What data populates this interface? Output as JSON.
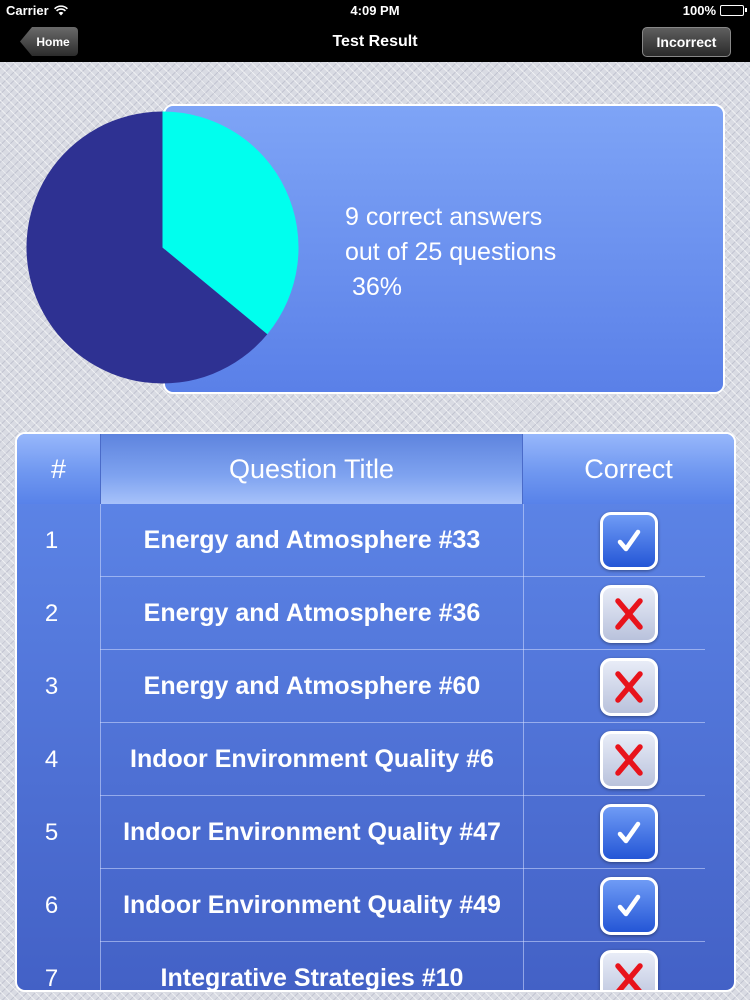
{
  "status_bar": {
    "carrier": "Carrier",
    "time": "4:09 PM",
    "battery": "100%"
  },
  "nav": {
    "home_label": "Home",
    "title": "Test Result",
    "incorrect_label": "Incorrect"
  },
  "summary": {
    "line1": "9 correct answers",
    "line2": "out of 25 questions",
    "line3": " 36%"
  },
  "chart_data": {
    "type": "pie",
    "slices": [
      {
        "label": "correct",
        "value": 36,
        "color": "#00ffee"
      },
      {
        "label": "incorrect",
        "value": 64,
        "color": "#2e3192"
      }
    ]
  },
  "table": {
    "headers": {
      "num": "#",
      "title": "Question Title",
      "correct": "Correct"
    },
    "rows": [
      {
        "num": "1",
        "title": "Energy and Atmosphere #33",
        "correct": true
      },
      {
        "num": "2",
        "title": "Energy and Atmosphere #36",
        "correct": false
      },
      {
        "num": "3",
        "title": "Energy and Atmosphere #60",
        "correct": false
      },
      {
        "num": "4",
        "title": "Indoor Environment Quality #6",
        "correct": false
      },
      {
        "num": "5",
        "title": "Indoor Environment Quality #47",
        "correct": true
      },
      {
        "num": "6",
        "title": "Indoor Environment Quality #49",
        "correct": true
      },
      {
        "num": "7",
        "title": "Integrative Strategies #10",
        "correct": false
      }
    ]
  },
  "colors": {
    "check_mark": "#ffffff",
    "cross_mark": "#e8131b",
    "panel": "#6b92f0"
  },
  "icons": {
    "check": "checkmark-icon",
    "cross": "x-mark-icon",
    "wifi": "wifi-icon",
    "battery": "battery-icon"
  }
}
